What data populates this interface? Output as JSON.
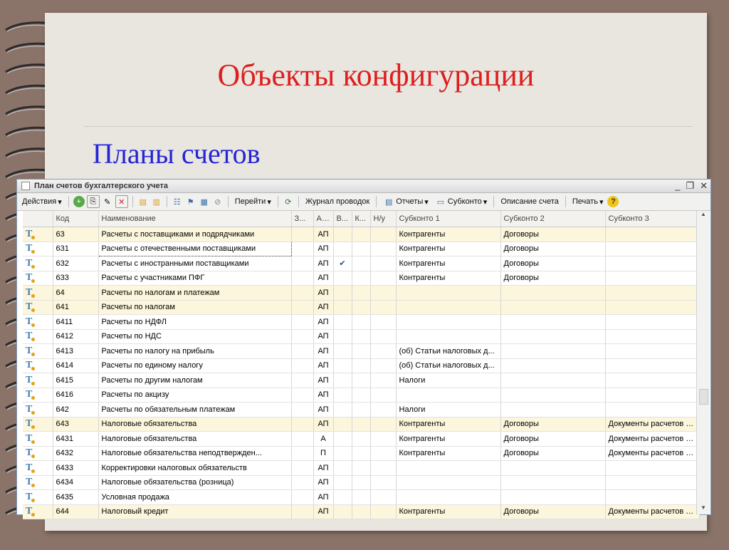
{
  "slide": {
    "title": "Объекты конфигурации",
    "subtitle": "Планы счетов"
  },
  "window": {
    "title": "План счетов бухгалтерского учета",
    "controls": [
      "_",
      "❐",
      "✕"
    ]
  },
  "toolbar": {
    "actions_label": "Действия",
    "goto_label": "Перейти",
    "journal_label": "Журнал проводок",
    "reports_label": "Отчеты",
    "subconto_label": "Субконто",
    "account_desc_label": "Описание счета",
    "print_label": "Печать",
    "help_label": "?"
  },
  "columns": [
    "",
    "Код",
    "Наименование",
    "З...",
    "Акт.",
    "В...",
    "К...",
    "Н/у",
    "Субконто 1",
    "Субконто 2",
    "Субконто 3"
  ],
  "rows": [
    {
      "code": "63",
      "name": "Расчеты с поставщиками и подрядчиками",
      "act": "АП",
      "v": "",
      "s1": "Контрагенты",
      "s2": "Договоры",
      "s3": "",
      "hl": true
    },
    {
      "code": "631",
      "name": "Расчеты с отечественными поставщиками",
      "act": "АП",
      "v": "",
      "s1": "Контрагенты",
      "s2": "Договоры",
      "s3": "",
      "hl": false,
      "sel": true
    },
    {
      "code": "632",
      "name": "Расчеты с иностранными поставщиками",
      "act": "АП",
      "v": "✔",
      "s1": "Контрагенты",
      "s2": "Договоры",
      "s3": "",
      "hl": false
    },
    {
      "code": "633",
      "name": "Расчеты с участниками ПФГ",
      "act": "АП",
      "v": "",
      "s1": "Контрагенты",
      "s2": "Договоры",
      "s3": "",
      "hl": false
    },
    {
      "code": "64",
      "name": "Расчеты по налогам и платежам",
      "act": "АП",
      "v": "",
      "s1": "",
      "s2": "",
      "s3": "",
      "hl": true
    },
    {
      "code": "641",
      "name": "Расчеты по налогам",
      "act": "АП",
      "v": "",
      "s1": "",
      "s2": "",
      "s3": "",
      "hl": true
    },
    {
      "code": "6411",
      "name": "Расчеты по НДФЛ",
      "act": "АП",
      "v": "",
      "s1": "",
      "s2": "",
      "s3": "",
      "hl": false
    },
    {
      "code": "6412",
      "name": "Расчеты по НДС",
      "act": "АП",
      "v": "",
      "s1": "",
      "s2": "",
      "s3": "",
      "hl": false
    },
    {
      "code": "6413",
      "name": "Расчеты по налогу на прибыль",
      "act": "АП",
      "v": "",
      "s1": "(об) Статьи налоговых д...",
      "s2": "",
      "s3": "",
      "hl": false
    },
    {
      "code": "6414",
      "name": "Расчеты по единому налогу",
      "act": "АП",
      "v": "",
      "s1": "(об) Статьи налоговых д...",
      "s2": "",
      "s3": "",
      "hl": false
    },
    {
      "code": "6415",
      "name": "Расчеты по другим налогам",
      "act": "АП",
      "v": "",
      "s1": "Налоги",
      "s2": "",
      "s3": "",
      "hl": false
    },
    {
      "code": "6416",
      "name": "Расчеты по акцизу",
      "act": "АП",
      "v": "",
      "s1": "",
      "s2": "",
      "s3": "",
      "hl": false
    },
    {
      "code": "642",
      "name": "Расчеты по обязательным платежам",
      "act": "АП",
      "v": "",
      "s1": "Налоги",
      "s2": "",
      "s3": "",
      "hl": false
    },
    {
      "code": "643",
      "name": "Налоговые обязательства",
      "act": "АП",
      "v": "",
      "s1": "Контрагенты",
      "s2": "Договоры",
      "s3": "Документы расчетов с ...",
      "hl": true
    },
    {
      "code": "6431",
      "name": "Налоговые обязательства",
      "act": "А",
      "v": "",
      "s1": "Контрагенты",
      "s2": "Договоры",
      "s3": "Документы расчетов с ...",
      "hl": false
    },
    {
      "code": "6432",
      "name": "Налоговые обязательства неподтвержден...",
      "act": "П",
      "v": "",
      "s1": "Контрагенты",
      "s2": "Договоры",
      "s3": "Документы расчетов с ...",
      "hl": false
    },
    {
      "code": "6433",
      "name": "Корректировки налоговых обязательств",
      "act": "АП",
      "v": "",
      "s1": "",
      "s2": "",
      "s3": "",
      "hl": false
    },
    {
      "code": "6434",
      "name": "Налоговые обязательства (розница)",
      "act": "АП",
      "v": "",
      "s1": "",
      "s2": "",
      "s3": "",
      "hl": false
    },
    {
      "code": "6435",
      "name": "Условная продажа",
      "act": "АП",
      "v": "",
      "s1": "",
      "s2": "",
      "s3": "",
      "hl": false
    },
    {
      "code": "644",
      "name": "Налоговый кредит",
      "act": "АП",
      "v": "",
      "s1": "Контрагенты",
      "s2": "Договоры",
      "s3": "Документы расчетов с ...",
      "hl": true
    }
  ],
  "row_icon": "Т",
  "colors": {
    "title": "#dd1f1f",
    "subtitle": "#2424d8",
    "highlight_row": "#fbf6dc",
    "paper": "#e9e6e0",
    "background": "#8a7368"
  }
}
